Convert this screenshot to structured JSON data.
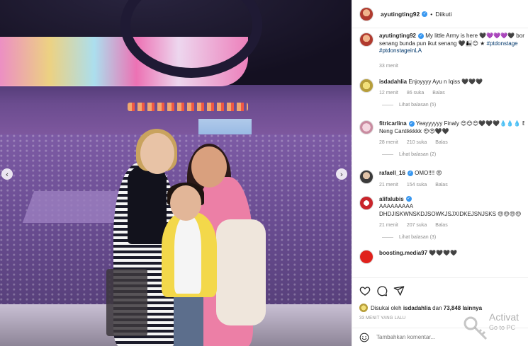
{
  "post": {
    "username": "ayutingting92",
    "follow_label": "Diikuti",
    "caption": {
      "line1": "My little Army is here 🖤💜💜💜🖤 borahae",
      "line2_text": "senang bunda pun ikut senang 🖤👩‍👧😊 ★",
      "hashtag1": "#ptdonstage",
      "hashtag2": "#ptdonstageinLA",
      "time": "33 menit"
    }
  },
  "comments": [
    {
      "username": "isdadahlia",
      "text": "Enjoyyyy Ayu n Iqiss 🖤🖤🖤",
      "time": "12 menit",
      "likes": "86 suka",
      "reply": "Balas",
      "replies": "Lihat balasan (5)",
      "avatar": "av-isda",
      "verified": false
    },
    {
      "username": "fitricarlina",
      "text": "Yeayyyyyy Finaly 😍😍😍🖤🖤🖤💧💧💧 Enjoy",
      "text2": "Neng Cantikkkkk 😍😍🖤🖤",
      "time": "28 menit",
      "likes": "210 suka",
      "reply": "Balas",
      "replies": "Lihat balasan (2)",
      "avatar": "av-fitri",
      "verified": true
    },
    {
      "username": "rafaell_16",
      "text": "OMO!!!! 😍",
      "time": "21 menit",
      "likes": "154 suka",
      "reply": "Balas",
      "avatar": "av-rafael",
      "verified": true
    },
    {
      "username": "alifalubis",
      "text": "AAAAAAAAA",
      "text2": "DHDJISKWNSKDJSOWKJSJXIDKEJSNJSKS 😍😍😍😍",
      "time": "21 menit",
      "likes": "207 suka",
      "reply": "Balas",
      "replies": "Lihat balasan (3)",
      "avatar": "av-alif",
      "verified": true
    },
    {
      "username": "boosting.media97",
      "text": "🖤🖤🖤🖤",
      "avatar": "av-boost",
      "verified": false
    }
  ],
  "actions": {
    "liked_by_prefix": "Disukai oleh",
    "liked_by_user": "isdadahlia",
    "liked_by_and": "dan",
    "likes_count": "73,848 lainnya",
    "timestamp": "33 MENIT YANG LALU",
    "comment_placeholder": "Tambahkan komentar..."
  },
  "watermark": {
    "title": "Activat",
    "subtitle": "Go to PC"
  },
  "icons": {
    "heart": "heart-icon",
    "comment": "comment-icon",
    "share": "share-icon",
    "emoji": "emoji-icon",
    "prev": "chevron-left-icon",
    "next": "chevron-right-icon"
  },
  "colors": {
    "link": "#00376b",
    "verified": "#3897f0",
    "muted": "#8e8e8e"
  },
  "carousel": {
    "prev_glyph": "‹",
    "next_glyph": "›"
  }
}
